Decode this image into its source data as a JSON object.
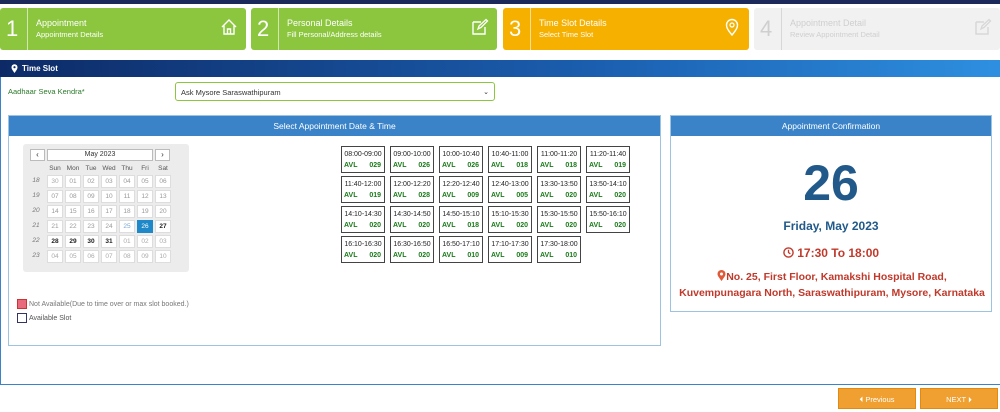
{
  "steps": [
    {
      "num": "1",
      "title": "Appointment",
      "sub": "Appointment Details",
      "icon": "home-icon"
    },
    {
      "num": "2",
      "title": "Personal Details",
      "sub": "Fill Personal/Address details",
      "icon": "edit-icon"
    },
    {
      "num": "3",
      "title": "Time Slot Details",
      "sub": "Select Time Slot",
      "icon": "location-pin-icon"
    },
    {
      "num": "4",
      "title": "Appointment Detail",
      "sub": "Review Appointment Detail",
      "icon": "edit-icon"
    }
  ],
  "section": {
    "title": "Time Slot"
  },
  "kendra": {
    "label": "Aadhaar Seva Kendra*",
    "value": "Ask Mysore Saraswathipuram"
  },
  "left_panel": {
    "title": "Select Appointment Date & Time"
  },
  "right_panel": {
    "title": "Appointment Confirmation"
  },
  "calendar": {
    "month": "May 2023",
    "prev": "‹",
    "next": "›",
    "dow": [
      "Sun",
      "Mon",
      "Tue",
      "Wed",
      "Thu",
      "Fri",
      "Sat"
    ],
    "weeks": [
      "18",
      "19",
      "20",
      "21",
      "22",
      "23"
    ],
    "days": [
      [
        "30",
        "01",
        "02",
        "03",
        "04",
        "05",
        "06"
      ],
      [
        "07",
        "08",
        "09",
        "10",
        "11",
        "12",
        "13"
      ],
      [
        "14",
        "15",
        "16",
        "17",
        "18",
        "19",
        "20"
      ],
      [
        "21",
        "22",
        "23",
        "24",
        "25",
        "26",
        "27"
      ],
      [
        "28",
        "29",
        "30",
        "31",
        "01",
        "02",
        "03"
      ],
      [
        "04",
        "05",
        "06",
        "07",
        "08",
        "09",
        "10"
      ]
    ]
  },
  "slots": [
    {
      "time": "08:00-09:00",
      "avl": "AVL",
      "count": "029"
    },
    {
      "time": "09:00-10:00",
      "avl": "AVL",
      "count": "026"
    },
    {
      "time": "10:00-10:40",
      "avl": "AVL",
      "count": "026"
    },
    {
      "time": "10:40-11:00",
      "avl": "AVL",
      "count": "018"
    },
    {
      "time": "11:00-11:20",
      "avl": "AVL",
      "count": "018"
    },
    {
      "time": "11:20-11:40",
      "avl": "AVL",
      "count": "019"
    },
    {
      "time": "11:40-12:00",
      "avl": "AVL",
      "count": "019"
    },
    {
      "time": "12:00-12:20",
      "avl": "AVL",
      "count": "028"
    },
    {
      "time": "12:20-12:40",
      "avl": "AVL",
      "count": "009"
    },
    {
      "time": "12:40-13:00",
      "avl": "AVL",
      "count": "005"
    },
    {
      "time": "13:30-13:50",
      "avl": "AVL",
      "count": "020"
    },
    {
      "time": "13:50-14:10",
      "avl": "AVL",
      "count": "020"
    },
    {
      "time": "14:10-14:30",
      "avl": "AVL",
      "count": "020"
    },
    {
      "time": "14:30-14:50",
      "avl": "AVL",
      "count": "020"
    },
    {
      "time": "14:50-15:10",
      "avl": "AVL",
      "count": "018"
    },
    {
      "time": "15:10-15:30",
      "avl": "AVL",
      "count": "020"
    },
    {
      "time": "15:30-15:50",
      "avl": "AVL",
      "count": "020"
    },
    {
      "time": "15:50-16:10",
      "avl": "AVL",
      "count": "020"
    },
    {
      "time": "16:10-16:30",
      "avl": "AVL",
      "count": "020"
    },
    {
      "time": "16:30-16:50",
      "avl": "AVL",
      "count": "020"
    },
    {
      "time": "16:50-17:10",
      "avl": "AVL",
      "count": "010"
    },
    {
      "time": "17:10-17:30",
      "avl": "AVL",
      "count": "009"
    },
    {
      "time": "17:30-18:00",
      "avl": "AVL",
      "count": "010"
    }
  ],
  "legend": {
    "not_available": "Not Available(Due to time over or max slot booked.)",
    "available": "Available Slot"
  },
  "confirmation": {
    "day": "26",
    "date": "Friday, May 2023",
    "time": "17:30 To 18:00",
    "address": "No. 25, First Floor, Kamakshi Hospital Road, Kuvempunagara North, Saraswathipuram, Mysore, Karnataka"
  },
  "footer": {
    "previous": "Previous",
    "next": "NEXT"
  },
  "colors": {
    "green": "#8cc63f",
    "orange": "#f5b000",
    "blue": "#3b83c8",
    "red": "#c0392b"
  }
}
